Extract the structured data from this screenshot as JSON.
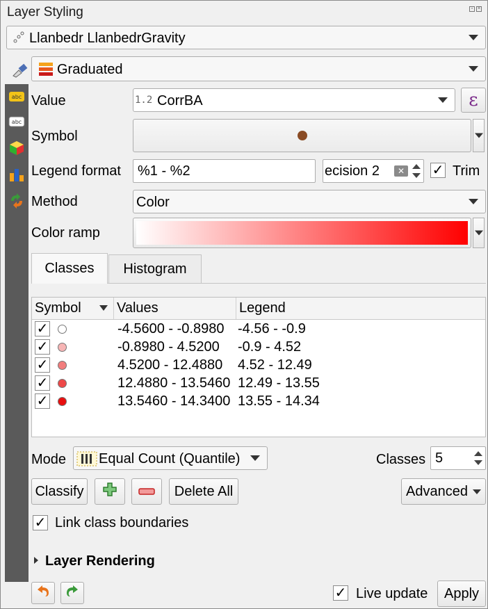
{
  "panel": {
    "title": "Layer Styling"
  },
  "layer": {
    "name": "Llanbedr LlanbedrGravity"
  },
  "renderer": {
    "name": "Graduated"
  },
  "value": {
    "label": "Value",
    "type_badge": "1.2",
    "field": "CorrBA",
    "expr_icon": "ε"
  },
  "symbol": {
    "label": "Symbol"
  },
  "legend_format": {
    "label": "Legend format",
    "value": "%1 - %2",
    "precision_text": "ecision 2",
    "trim_label": "Trim"
  },
  "method": {
    "label": "Method",
    "value": "Color"
  },
  "color_ramp": {
    "label": "Color ramp",
    "start_color": "#ffffff",
    "end_color": "#ff0000"
  },
  "tabs": {
    "classes": "Classes",
    "histogram": "Histogram"
  },
  "table": {
    "headers": {
      "symbol": "Symbol",
      "values": "Values",
      "legend": "Legend"
    },
    "rows": [
      {
        "values": "-4.5600 - -0.8980",
        "legend": "-4.56 - -0.9",
        "color": "#ffffff"
      },
      {
        "values": "-0.8980 - 4.5200",
        "legend": "-0.9 - 4.52",
        "color": "#f7b5b5"
      },
      {
        "values": "4.5200 - 12.4880",
        "legend": "4.52 - 12.49",
        "color": "#f27d7d"
      },
      {
        "values": "12.4880 - 13.5460",
        "legend": "12.49 - 13.55",
        "color": "#ee4848"
      },
      {
        "values": "13.5460 - 14.3400",
        "legend": "13.55 - 14.34",
        "color": "#e80f0f"
      }
    ]
  },
  "mode": {
    "label": "Mode",
    "value": "Equal Count (Quantile)"
  },
  "classes_count": {
    "label": "Classes",
    "value": "5"
  },
  "buttons": {
    "classify": "Classify",
    "delete_all": "Delete All",
    "advanced": "Advanced"
  },
  "link_boundaries": {
    "label": "Link class boundaries"
  },
  "layer_rendering": {
    "label": "Layer Rendering"
  },
  "footer": {
    "live_update": "Live update",
    "apply": "Apply"
  },
  "colors": {
    "accent_orange": "#e8741c",
    "accent_green": "#3a9a3a",
    "sidebar": "#5a5a5a"
  },
  "icons": {
    "strip": [
      "labels-icon",
      "abc-icon",
      "3d-cube-icon",
      "diagrams-icon",
      "history-icon"
    ]
  }
}
